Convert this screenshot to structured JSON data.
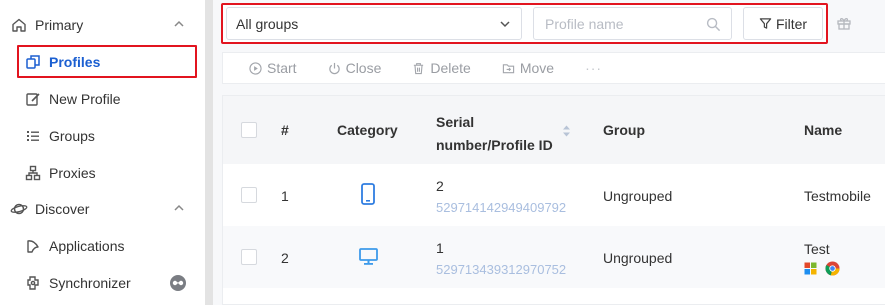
{
  "sidebar": {
    "sections": [
      {
        "label": "Primary",
        "icon": "home-icon"
      },
      {
        "label": "Discover",
        "icon": "planet-icon"
      }
    ],
    "items": [
      {
        "label": "Profiles",
        "icon": "profiles-icon",
        "active": true
      },
      {
        "label": "New Profile",
        "icon": "edit-icon"
      },
      {
        "label": "Groups",
        "icon": "list-icon"
      },
      {
        "label": "Proxies",
        "icon": "network-icon"
      },
      {
        "label": "Applications",
        "icon": "applications-icon"
      },
      {
        "label": "Synchronizer",
        "icon": "sync-icon"
      }
    ]
  },
  "toolbar": {
    "group_select_value": "All groups",
    "search_placeholder": "Profile name",
    "filter_label": "Filter"
  },
  "actions": [
    {
      "label": "Start",
      "icon": "play-icon"
    },
    {
      "label": "Close",
      "icon": "power-icon"
    },
    {
      "label": "Delete",
      "icon": "trash-icon"
    },
    {
      "label": "Move",
      "icon": "folder-icon"
    },
    {
      "label": "···",
      "icon": "more-icon"
    }
  ],
  "table": {
    "columns": {
      "index": "#",
      "category": "Category",
      "serial_line1": "Serial",
      "serial_line2": "number/Profile ID",
      "group": "Group",
      "name": "Name"
    },
    "rows": [
      {
        "index": "1",
        "category": "mobile-icon",
        "serial": "2",
        "profile_id": "529714142949409792",
        "group": "Ungrouped",
        "name": "Testmobile"
      },
      {
        "index": "2",
        "category": "desktop-icon",
        "serial": "1",
        "profile_id": "529713439312970752",
        "group": "Ungrouped",
        "name": "Test",
        "badges": [
          "windows-icon",
          "chrome-icon"
        ]
      }
    ]
  },
  "colors": {
    "accent": "#1b5fd1",
    "highlight_border": "#e2141f",
    "device_icon": "#2f7de1",
    "profile_id": "#a9bedf"
  }
}
